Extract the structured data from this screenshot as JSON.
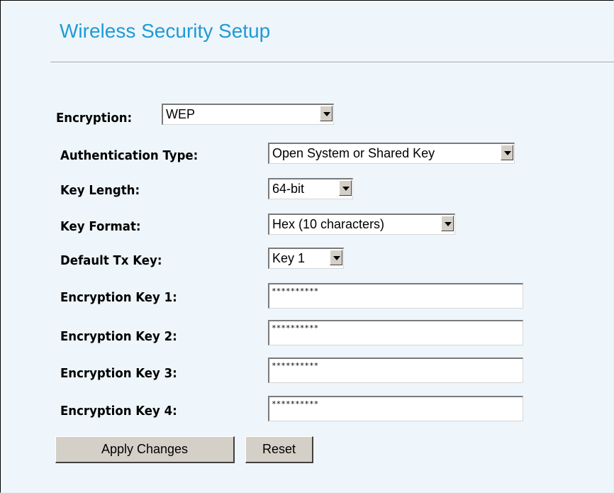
{
  "page": {
    "title": "Wireless Security Setup"
  },
  "form": {
    "encryption": {
      "label": "Encryption:",
      "value": "WEP"
    },
    "auth_type": {
      "label": "Authentication Type:",
      "value": "Open System or Shared Key"
    },
    "key_length": {
      "label": "Key Length:",
      "value": "64-bit"
    },
    "key_format": {
      "label": "Key Format:",
      "value": "Hex (10 characters)"
    },
    "default_tx_key": {
      "label": "Default Tx Key:",
      "value": "Key 1"
    },
    "keys": [
      {
        "label": "Encryption Key 1:",
        "value": "**********"
      },
      {
        "label": "Encryption Key 2:",
        "value": "**********"
      },
      {
        "label": "Encryption Key 3:",
        "value": "**********"
      },
      {
        "label": "Encryption Key 4:",
        "value": "**********"
      }
    ]
  },
  "buttons": {
    "apply": "Apply Changes",
    "reset": "Reset"
  },
  "colors": {
    "title": "#1f9ad6",
    "background": "#eef6fb",
    "button_face": "#d4d0c8"
  },
  "icons": {
    "dropdown": "chevron-down-icon"
  }
}
